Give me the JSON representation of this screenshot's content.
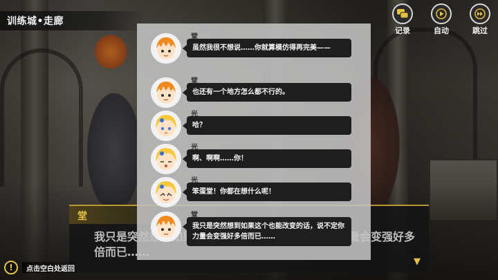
{
  "location": {
    "title": "训练城•走廊"
  },
  "controls": [
    {
      "icon": "log-icon",
      "label": "记录"
    },
    {
      "icon": "auto-play-icon",
      "label": "自动"
    },
    {
      "icon": "skip-icon",
      "label": "跳过"
    }
  ],
  "dialogue": {
    "speaker": "堂",
    "text": "我只是突然想到如果这个也能改变的话，说不定你力量会变强好多倍而已……"
  },
  "hint": {
    "text": "点击空白处返回"
  },
  "log": [
    {
      "speaker": "堂",
      "avatar": "dou",
      "text": "虽然我很不想说……你就算模仿得再完美——"
    },
    {
      "speaker": "堂",
      "avatar": "dou",
      "text": "也还有一个地方怎么都不行的。"
    },
    {
      "speaker": "光",
      "avatar": "hikari",
      "text": "哈？"
    },
    {
      "speaker": "光",
      "avatar": "hikari",
      "text": "啊、啊啊……你！"
    },
    {
      "speaker": "光",
      "avatar": "hikari",
      "text": "笨蛋堂！你都在想什么呢！"
    },
    {
      "speaker": "堂",
      "avatar": "dou",
      "text": "我只是突然想到如果这个也能改变的话，说不定你力量会变强好多倍而已……"
    }
  ],
  "colors": {
    "accent": "#e5c144",
    "bubble": "#1e1e1e",
    "panel": "#c3c3c3"
  }
}
